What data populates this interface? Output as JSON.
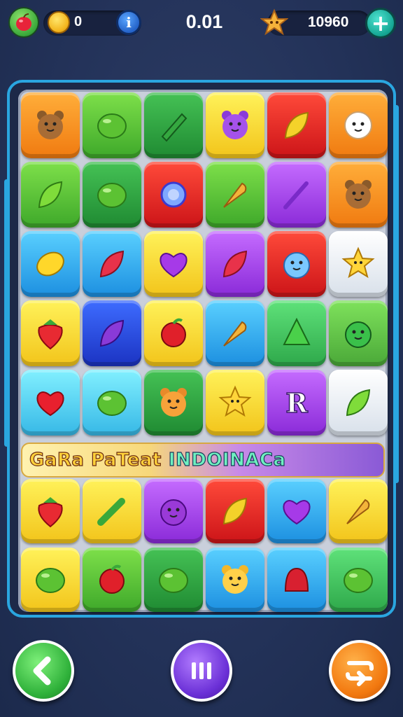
{
  "hud": {
    "coins": "0",
    "info_label": "i",
    "timer": "0.01",
    "score": "10960",
    "plus_label": "+"
  },
  "banner": {
    "text_part1": "GaRa PaTeat",
    "text_part2": "INDOINACa"
  },
  "board": {
    "top_rows": [
      [
        {
          "tile": "orange",
          "piece": "bear-face-icon"
        },
        {
          "tile": "green",
          "piece": "lime-icon"
        },
        {
          "tile": "dgreen",
          "piece": "pencil-icon"
        },
        {
          "tile": "yellow",
          "piece": "purple-bear-icon"
        },
        {
          "tile": "red",
          "piece": "yellow-leaf-icon"
        },
        {
          "tile": "orange",
          "piece": "white-ghost-icon"
        }
      ],
      [
        {
          "tile": "green",
          "piece": "leaf-icon"
        },
        {
          "tile": "dgreen",
          "piece": "lime-icon"
        },
        {
          "tile": "red",
          "piece": "blue-ring-icon"
        },
        {
          "tile": "green",
          "piece": "carrot-icon"
        },
        {
          "tile": "purple",
          "piece": "purple-stick-icon"
        },
        {
          "tile": "orange",
          "piece": "bear-face-icon"
        }
      ],
      [
        {
          "tile": "blue",
          "piece": "lemon-icon"
        },
        {
          "tile": "blue",
          "piece": "red-leaf-icon"
        },
        {
          "tile": "yellow",
          "piece": "purple-heart-icon"
        },
        {
          "tile": "purple",
          "piece": "red-leaf-icon"
        },
        {
          "tile": "red",
          "piece": "blue-cat-icon"
        },
        {
          "tile": "white",
          "piece": "star-icon"
        }
      ],
      [
        {
          "tile": "yellow",
          "piece": "strawberry-icon"
        },
        {
          "tile": "dblue",
          "piece": "purple-leaf-icon"
        },
        {
          "tile": "yellow",
          "piece": "apple-icon"
        },
        {
          "tile": "blue",
          "piece": "carrot-icon"
        },
        {
          "tile": "ltgreen",
          "piece": "green-cone-icon"
        },
        {
          "tile": "lime",
          "piece": "green-frog-icon"
        }
      ],
      [
        {
          "tile": "cyan",
          "piece": "heart-icon"
        },
        {
          "tile": "cyan",
          "piece": "lime-icon"
        },
        {
          "tile": "dgreen",
          "piece": "orange-bear-icon"
        },
        {
          "tile": "yellow",
          "piece": "star-icon"
        },
        {
          "tile": "purple",
          "piece": "letter-r-icon"
        },
        {
          "tile": "white",
          "piece": "leaf-icon"
        }
      ]
    ],
    "bottom_rows": [
      [
        {
          "tile": "yellow",
          "piece": "strawberry-icon"
        },
        {
          "tile": "yellow",
          "piece": "green-bean-icon"
        },
        {
          "tile": "purple",
          "piece": "purple-blob-icon"
        },
        {
          "tile": "red",
          "piece": "yellow-leaf-icon"
        },
        {
          "tile": "blue",
          "piece": "purple-heart-icon"
        },
        {
          "tile": "yellow",
          "piece": "carrot-icon"
        }
      ],
      [
        {
          "tile": "yellow",
          "piece": "lime-icon"
        },
        {
          "tile": "green",
          "piece": "apple-icon"
        },
        {
          "tile": "dgreen",
          "piece": "lime-icon"
        },
        {
          "tile": "blue",
          "piece": "yellow-bear-icon"
        },
        {
          "tile": "blue",
          "piece": "red-bell-icon"
        },
        {
          "tile": "ltgreen",
          "piece": "lime-icon"
        }
      ]
    ],
    "letter_r": "R"
  },
  "controls": {
    "back": "back-arrow-icon",
    "pause": "pause-icon",
    "next": "shuffle-icon"
  }
}
